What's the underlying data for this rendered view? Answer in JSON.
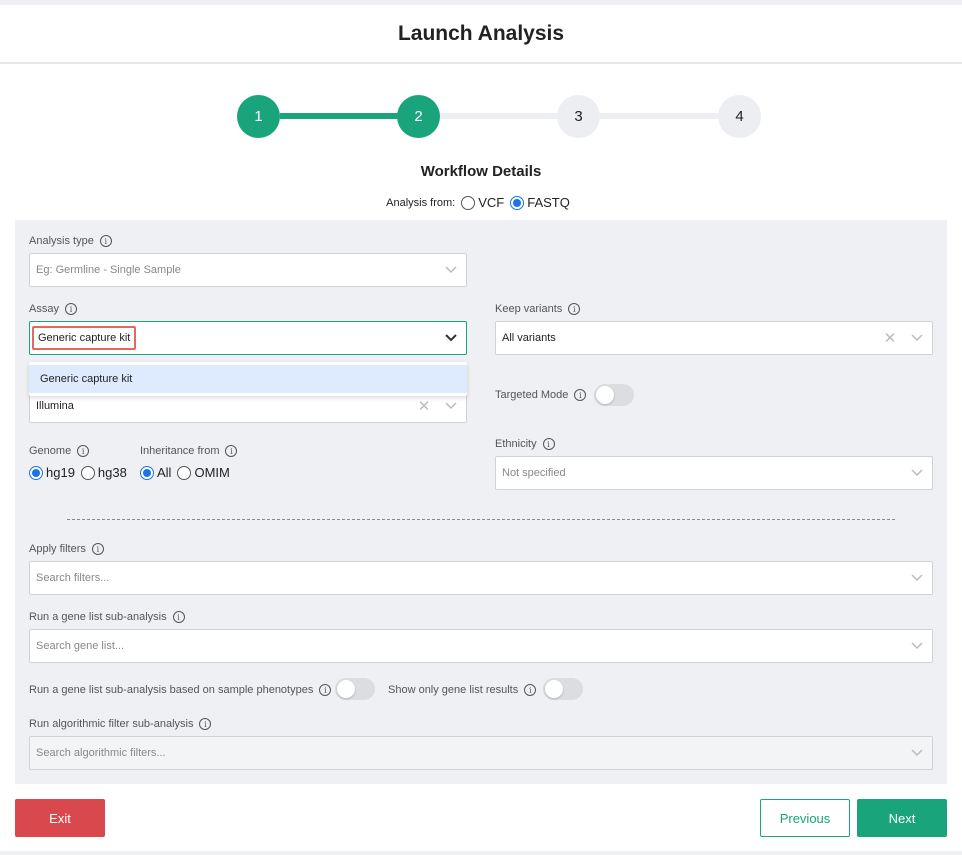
{
  "header": {
    "title": "Launch Analysis"
  },
  "stepper": {
    "steps": [
      "1",
      "2",
      "3",
      "4"
    ],
    "current_step": 2
  },
  "workflow": {
    "title": "Workflow Details"
  },
  "analysis_from": {
    "label": "Analysis from:",
    "options": [
      "VCF",
      "FASTQ"
    ],
    "selected": "FASTQ"
  },
  "form": {
    "analysis_type": {
      "label": "Analysis type",
      "placeholder": "Eg: Germline - Single Sample"
    },
    "assay": {
      "label": "Assay",
      "value": "Generic capture kit",
      "dropdown_option": "Generic capture kit"
    },
    "platform": {
      "value": "Illumina"
    },
    "keep_variants": {
      "label": "Keep variants",
      "value": "All variants"
    },
    "targeted_mode": {
      "label": "Targeted Mode"
    },
    "genome": {
      "label": "Genome",
      "options": [
        "hg19",
        "hg38"
      ],
      "selected": "hg19"
    },
    "inheritance": {
      "label": "Inheritance from",
      "options": [
        "All",
        "OMIM"
      ],
      "selected": "All"
    },
    "ethnicity": {
      "label": "Ethnicity",
      "value": "Not specified"
    },
    "apply_filters": {
      "label": "Apply filters",
      "placeholder": "Search filters..."
    },
    "gene_list": {
      "label": "Run a gene list sub-analysis",
      "placeholder": "Search gene list..."
    },
    "phenotype_toggle": {
      "label": "Run a gene list sub-analysis based on sample phenotypes"
    },
    "show_gene_list_toggle": {
      "label": "Show only gene list results"
    },
    "algorithmic": {
      "label": "Run algorithmic filter sub-analysis",
      "placeholder": "Search algorithmic filters..."
    }
  },
  "footer": {
    "exit": "Exit",
    "previous": "Previous",
    "next": "Next"
  },
  "colors": {
    "accent": "#1aa47b",
    "danger": "#d9484d",
    "highlight": "#e06a5e"
  }
}
